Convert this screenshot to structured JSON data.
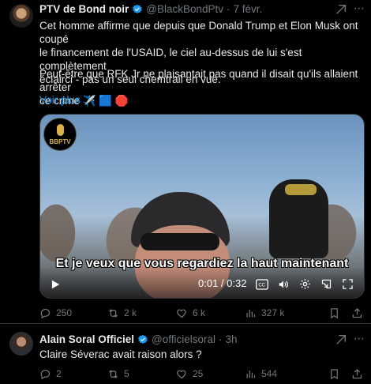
{
  "tweets": [
    {
      "author": "PTV de Bond noir",
      "handle": "@BlackBondPtv",
      "separator": "·",
      "time": "7 févr.",
      "text": "Cet homme affirme que depuis que Donald Trump et Elon Musk ont coupé\nle financement de l'USAID, le ciel au-dessus de lui s'est complètement\néclairci - pas un seul chemtrail en vue.",
      "text2": "Peut-être que RFK Jr ne plaisantait pas quand il disait qu'ils allaient arrêter\nce crime ✈️ 🟦 🛑",
      "show_more": "Voir plus",
      "video": {
        "logo_text": "BBPTV",
        "caption": "Et je veux que vous regardiez la haut maintenant",
        "time": "0:01 / 0:32"
      },
      "stats": {
        "replies": "250",
        "reposts": "2 k",
        "likes": "6 k",
        "views": "327 k"
      }
    },
    {
      "author": "Alain Soral Officiel",
      "handle": "@officielsoral",
      "separator": "·",
      "time": "3h",
      "text": "Claire Séverac avait raison alors ?",
      "stats": {
        "replies": "2",
        "reposts": "5",
        "likes": "25",
        "views": "544"
      }
    }
  ],
  "colors": {
    "accent": "#1d9bf0",
    "muted": "#71767b",
    "text": "#e7e9ea",
    "background": "#000000"
  }
}
